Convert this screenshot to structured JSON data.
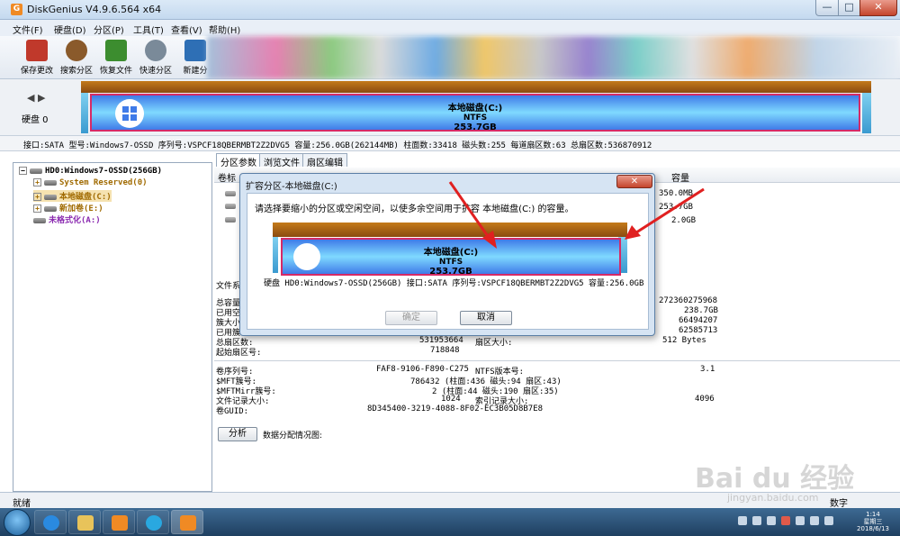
{
  "window": {
    "title": "DiskGenius V4.9.6.564 x64",
    "app_icon": "G",
    "min": "—",
    "max": "□",
    "close": "✕"
  },
  "menu": [
    "文件(F)",
    "硬盘(D)",
    "分区(P)",
    "工具(T)",
    "查看(V)",
    "帮助(H)"
  ],
  "toolbar": [
    {
      "label": "保存更改",
      "icon": "save-icon",
      "color": "#c0392b"
    },
    {
      "label": "搜索分区",
      "icon": "magnifier-icon",
      "color": "#8a5a2b"
    },
    {
      "label": "恢复文件",
      "icon": "recover-files-icon",
      "color": "#3c8d2f"
    },
    {
      "label": "快速分区",
      "icon": "quick-partition-icon",
      "color": "#7a8a99"
    },
    {
      "label": "新建分",
      "icon": "new-partition-icon",
      "color": "#2e6fb5"
    }
  ],
  "diskmap": {
    "nav": "◀ ▶",
    "disk_label": "硬盘 0",
    "partition": {
      "name": "本地磁盘(C:)",
      "fs": "NTFS",
      "size": "253.7GB"
    }
  },
  "infobar": "接口:SATA  型号:Windows7-OSSD  序列号:VSPCF18QBERMBT2Z2DVG5  容量:256.0GB(262144MB)  柱面数:33418  磁头数:255  每道扇区数:63  总扇区数:536870912",
  "tree": {
    "disk": "HD0:Windows7-OSSD(256GB)",
    "items": [
      {
        "label": "System Reserved(0)",
        "color": "#a06a00"
      },
      {
        "label": "本地磁盘(C:)",
        "color": "#a06a00"
      },
      {
        "label": "新加卷(E:)",
        "color": "#a06a00"
      }
    ],
    "unformatted": "未格式化(A:)"
  },
  "tabs": [
    "分区参数",
    "浏览文件",
    "扇区编辑"
  ],
  "grid": {
    "headers": [
      "卷标",
      "容量"
    ],
    "capacities": [
      "350.0MB",
      "253.7GB",
      "2.0GB"
    ]
  },
  "details": {
    "section_label": "文件系",
    "rows_left": [
      {
        "label": "总容量",
        "value": "272360275968"
      },
      {
        "label": "已用空",
        "value": "238.7GB"
      },
      {
        "label": "簇大小",
        "value": "66494207"
      },
      {
        "label": "已用簇",
        "value": "62585713"
      },
      {
        "label": "总扇区数:",
        "mid": "531953664",
        "mid_label": "扇区大小:",
        "value": "512 Bytes"
      },
      {
        "label": "起始扇区号:",
        "mid": "718848",
        "mid_label": "",
        "value": ""
      }
    ],
    "rows_fs": [
      {
        "label": "卷序列号:",
        "mid": "FAF8-9106-F890-C275",
        "mid_label": "NTFS版本号:",
        "value": "3.1"
      },
      {
        "label": "$MFT簇号:",
        "mid": "786432 (柱面:436 磁头:94 扇区:43)",
        "mid_label": "",
        "value": ""
      },
      {
        "label": "$MFTMirr簇号:",
        "mid": "2 (柱面:44 磁头:190 扇区:35)",
        "mid_label": "",
        "value": ""
      },
      {
        "label": "文件记录大小:",
        "mid": "1024",
        "mid_label": "索引记录大小:",
        "value": "4096"
      },
      {
        "label": "卷GUID:",
        "mid": "8D345400-3219-4088-8F02-EC3B05D8B7E8",
        "mid_label": "",
        "value": ""
      }
    ],
    "analyze_button": "分析",
    "alloc_label": "数据分配情况图:"
  },
  "status": {
    "left": "就绪",
    "right": "数字"
  },
  "taskbar": {
    "clock_time": "1:14",
    "clock_day": "星期三",
    "clock_date": "2018/6/13"
  },
  "dialog": {
    "title": "扩容分区-本地磁盘(C:)",
    "close": "✕",
    "prompt": "请选择要缩小的分区或空闲空间，以使多余空间用于扩容 本地磁盘(C:) 的容量。",
    "partition": {
      "name": "本地磁盘(C:)",
      "fs": "NTFS",
      "size": "253.7GB"
    },
    "info": "硬盘 HD0:Windows7-OSSD(256GB)  接口:SATA  序列号:VSPCF18QBERMBT2Z2DVG5  容量:256.0GB",
    "ok": "确定",
    "cancel": "取消"
  },
  "watermark": {
    "text": "Bai du 经验",
    "url": "jingyan.baidu.com"
  },
  "colors": {
    "accent_red": "#e02020",
    "partition_border": "#d62a66"
  }
}
